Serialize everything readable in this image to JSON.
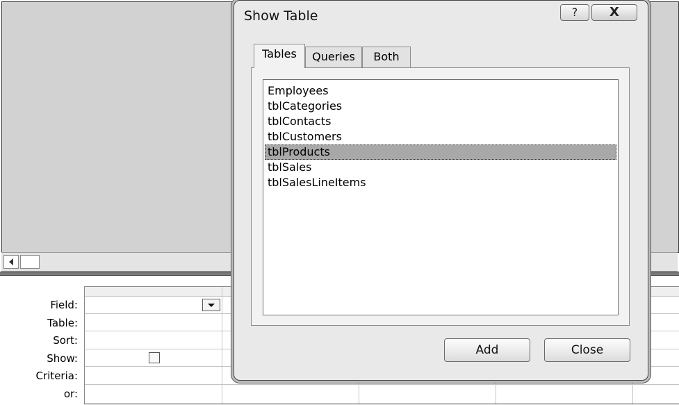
{
  "dialog": {
    "title": "Show Table",
    "help_glyph": "?",
    "close_glyph": "X",
    "tabs": [
      {
        "label": "Tables",
        "active": true
      },
      {
        "label": "Queries",
        "active": false
      },
      {
        "label": "Both",
        "active": false
      }
    ],
    "tables": [
      "Employees",
      "tblCategories",
      "tblContacts",
      "tblCustomers",
      "tblProducts",
      "tblSales",
      "tblSalesLineItems"
    ],
    "selected_table": "tblProducts",
    "add_label": "Add",
    "close_label": "Close"
  },
  "grid": {
    "row_labels": [
      "Field:",
      "Table:",
      "Sort:",
      "Show:",
      "Criteria:",
      "or:"
    ]
  }
}
